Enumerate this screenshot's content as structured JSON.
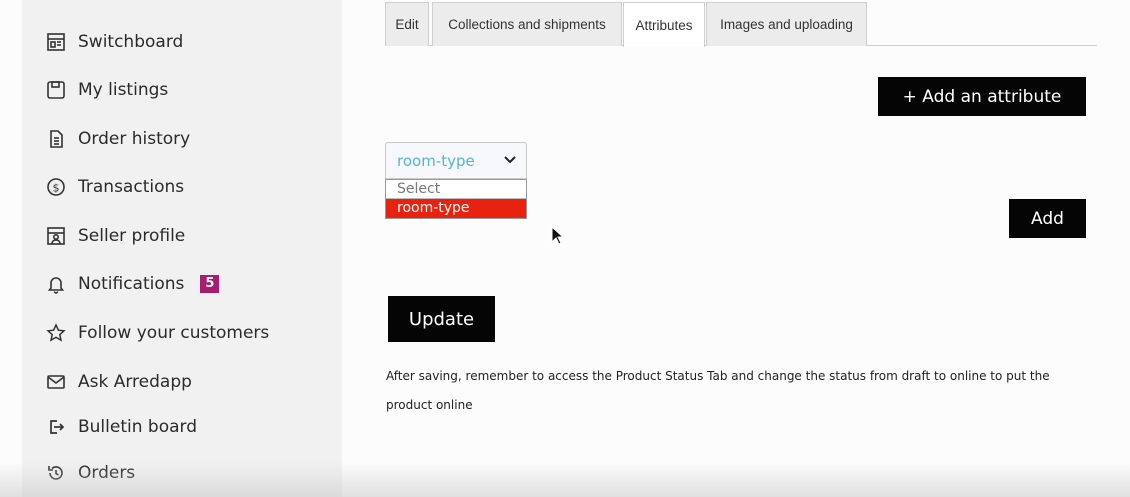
{
  "sidebar": {
    "items": [
      {
        "label": "Switchboard",
        "icon": "switchboard-icon"
      },
      {
        "label": "My listings",
        "icon": "save-icon"
      },
      {
        "label": "Order history",
        "icon": "document-icon"
      },
      {
        "label": "Transactions",
        "icon": "dollar-circle-icon"
      },
      {
        "label": "Seller profile",
        "icon": "store-profile-icon"
      },
      {
        "label": "Notifications",
        "icon": "bell-icon",
        "badge": "5"
      },
      {
        "label": "Follow your customers",
        "icon": "star-icon"
      },
      {
        "label": "Ask Arredapp",
        "icon": "mail-icon"
      },
      {
        "label": "Bulletin board",
        "icon": "exit-icon"
      },
      {
        "label": "Orders",
        "icon": "history-icon"
      }
    ]
  },
  "tabs": [
    {
      "label": "Edit"
    },
    {
      "label": "Collections and shipments"
    },
    {
      "label": "Attributes",
      "active": true
    },
    {
      "label": "Images and uploading"
    }
  ],
  "main": {
    "add_attribute_label": "+ Add an attribute",
    "select_value": "room-type",
    "dropdown_options": [
      "Select",
      "room-type"
    ],
    "add_label": "Add",
    "update_label": "Update",
    "note": "After saving, remember to access the Product Status Tab and change the status from draft to online to put the product online"
  },
  "colors": {
    "badge": "#a81e6e",
    "select_text": "#53b6cf",
    "highlight": "#e8220e",
    "button": "#050505"
  }
}
